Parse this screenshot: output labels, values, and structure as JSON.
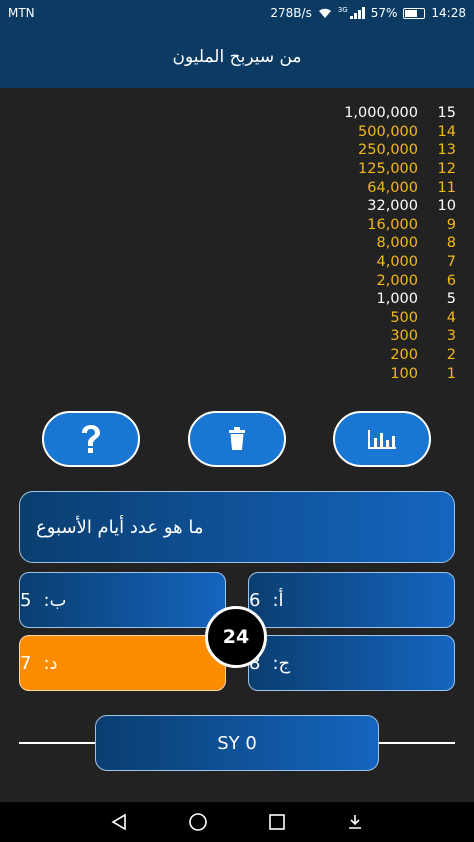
{
  "status_bar": {
    "carrier": "MTN",
    "speed": "278B/s",
    "network": "3G",
    "battery": "57%",
    "time": "14:28"
  },
  "app_bar": {
    "title": "من سيربح المليون"
  },
  "ladder": [
    {
      "level": "15",
      "amount": "1,000,000",
      "milestone": true
    },
    {
      "level": "14",
      "amount": "500,000",
      "milestone": false
    },
    {
      "level": "13",
      "amount": "250,000",
      "milestone": false
    },
    {
      "level": "12",
      "amount": "125,000",
      "milestone": false
    },
    {
      "level": "11",
      "amount": "64,000",
      "milestone": false
    },
    {
      "level": "10",
      "amount": "32,000",
      "milestone": true
    },
    {
      "level": "9",
      "amount": "16,000",
      "milestone": false
    },
    {
      "level": "8",
      "amount": "8,000",
      "milestone": false
    },
    {
      "level": "7",
      "amount": "4,000",
      "milestone": false
    },
    {
      "level": "6",
      "amount": "2,000",
      "milestone": false
    },
    {
      "level": "5",
      "amount": "1,000",
      "milestone": true
    },
    {
      "level": "4",
      "amount": "500",
      "milestone": false
    },
    {
      "level": "3",
      "amount": "300",
      "milestone": false
    },
    {
      "level": "2",
      "amount": "200",
      "milestone": false
    },
    {
      "level": "1",
      "amount": "100",
      "milestone": false
    }
  ],
  "lifelines": {
    "help_icon": "question-mark-icon",
    "delete_icon": "trash-icon",
    "audience_icon": "bar-chart-icon"
  },
  "question": {
    "text": "ما هو عدد أيام الأسبوع"
  },
  "answers": {
    "a": {
      "letter": "أ:",
      "value": "6"
    },
    "b": {
      "letter": "ب:",
      "value": "5"
    },
    "c": {
      "letter": "ج:",
      "value": "8"
    },
    "d": {
      "letter": "د:",
      "value": "7"
    }
  },
  "timer": {
    "value": "24"
  },
  "score": {
    "text": "SY 0"
  },
  "colors": {
    "primary": "#1976d2",
    "dark_blue": "#0b3a63",
    "selected": "#fb8c00",
    "milestone": "#ffffff",
    "regular": "#f2b81c"
  }
}
